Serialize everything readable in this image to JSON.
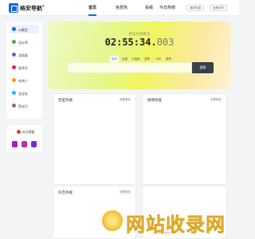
{
  "header": {
    "logo_text": "格安导航",
    "logo_badge": "®",
    "nav": [
      "首页",
      "免费热",
      "投稿",
      "今日热榜"
    ],
    "login_label": "我的热搜",
    "submit_label": "投稿合作"
  },
  "sidebar": {
    "items": [
      {
        "label": "AI模型",
        "icon": "ai-icon",
        "color": "#1b66d6"
      },
      {
        "label": "设计师",
        "icon": "design-icon",
        "color": "#4caf50"
      },
      {
        "label": "游戏娱",
        "icon": "game-icon",
        "color": "#7e57c2"
      },
      {
        "label": "程序员",
        "icon": "code-icon",
        "color": "#e91e63"
      },
      {
        "label": "毛病人",
        "icon": "user-icon",
        "color": "#ff9800"
      },
      {
        "label": "宝宝站",
        "icon": "baby-icon",
        "color": "#29b6f6"
      },
      {
        "label": "黑宝贝",
        "icon": "star-icon",
        "color": "#8d6e63"
      }
    ]
  },
  "partner": {
    "label": "站点联盟",
    "icon": "partner-icon"
  },
  "hero": {
    "subtitle": "格安热搜聚合",
    "clock_main": "02:55:34.",
    "clock_ms": "003",
    "engines": [
      "站内",
      "百度",
      "小搜索",
      "谷歌",
      "360",
      "搜狗"
    ],
    "search_placeholder": "",
    "search_button": "搜索"
  },
  "cards": [
    {
      "title": "百度热搜",
      "more": "查看更多"
    },
    {
      "title": "微博热搜",
      "more": "查看更多"
    },
    {
      "title": "抖音热搜",
      "more": "查看更多"
    }
  ],
  "watermark": {
    "text": "网站收录网",
    "url": "wzsl.com"
  },
  "colors": {
    "accent": "#1b66d6",
    "search_button": "#3a3f4a",
    "hero_gradient": [
      "#eefac6",
      "#e4f78a",
      "#f0f560",
      "#fbe9a4"
    ]
  }
}
